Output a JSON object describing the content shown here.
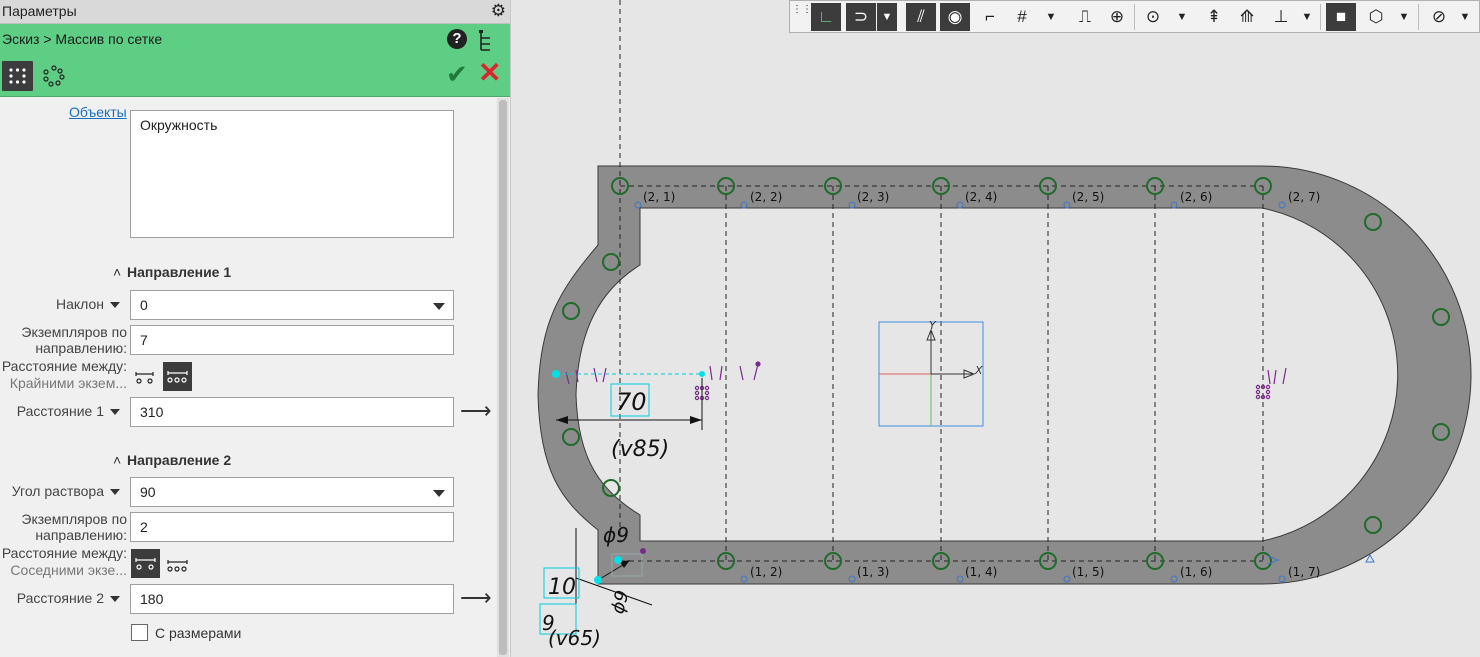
{
  "panel": {
    "title": "Параметры",
    "breadcrumb": "Эскиз > Массив по сетке",
    "objects_label": "Объекты",
    "objects_value": "Окружность",
    "direction1": {
      "header": "Направление 1",
      "tilt_label": "Наклон",
      "tilt_value": "0",
      "count_label": "Экземпляров по направлению:",
      "count_value": "7",
      "distance_between_label": "Расстояние между:",
      "distance_between_mode": "Крайними экзем...",
      "distance_label": "Расстояние 1",
      "distance_value": "310"
    },
    "direction2": {
      "header": "Направление 2",
      "angle_label": "Угол раствора",
      "angle_value": "90",
      "count_label": "Экземпляров по направлению:",
      "count_value": "2",
      "distance_between_label": "Расстояние между:",
      "distance_between_mode": "Соседними экзе...",
      "distance_label": "Расстояние 2",
      "distance_value": "180"
    },
    "with_dimensions_label": "С размерами"
  },
  "canvas": {
    "top_labels": [
      "(2, 1)",
      "(2, 2)",
      "(2, 3)",
      "(2, 4)",
      "(2, 5)",
      "(2, 6)",
      "(2, 7)"
    ],
    "bottom_labels": [
      "(1, 2)",
      "(1, 3)",
      "(1, 4)",
      "(1, 5)",
      "(1, 6)",
      "(1, 7)"
    ],
    "dim_70": "70",
    "dim_v85": "(v85)",
    "dim_phi9": "ϕ9",
    "dim_10": "10",
    "dim_9": "9",
    "dim_v65": "(v65)",
    "dim_phi9b": "ϕ9",
    "axis_x": "X",
    "axis_y": "Y"
  },
  "colors": {
    "header_green": "#5fce85",
    "shape_gray": "#8c8c8c",
    "circle_green": "#1f6b2a",
    "constraint_purple": "#7a2a8a",
    "dim_cyan": "#00e0e8"
  }
}
